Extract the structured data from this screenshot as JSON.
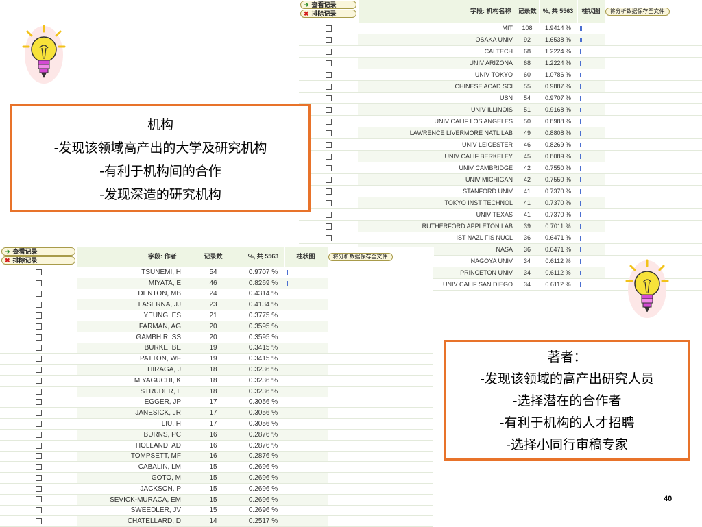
{
  "institution_table": {
    "buttons": {
      "view_records": "查看记录",
      "exclude_records": "排除记录"
    },
    "headers": {
      "field": "字段: 机构名称",
      "records": "记录数",
      "percent": "%, 共 5563",
      "bar": "柱状图",
      "save": "将分析数据保存至文件"
    },
    "rows": [
      {
        "name": "MIT",
        "count": "108",
        "pct": "1.9414 %",
        "share": 1.9414
      },
      {
        "name": "OSAKA UNIV",
        "count": "92",
        "pct": "1.6538 %",
        "share": 1.6538
      },
      {
        "name": "CALTECH",
        "count": "68",
        "pct": "1.2224 %",
        "share": 1.2224
      },
      {
        "name": "UNIV ARIZONA",
        "count": "68",
        "pct": "1.2224 %",
        "share": 1.2224
      },
      {
        "name": "UNIV TOKYO",
        "count": "60",
        "pct": "1.0786 %",
        "share": 1.0786
      },
      {
        "name": "CHINESE ACAD SCI",
        "count": "55",
        "pct": "0.9887 %",
        "share": 0.9887
      },
      {
        "name": "USN",
        "count": "54",
        "pct": "0.9707 %",
        "share": 0.9707
      },
      {
        "name": "UNIV ILLINOIS",
        "count": "51",
        "pct": "0.9168 %",
        "share": 0.9168
      },
      {
        "name": "UNIV CALIF LOS ANGELES",
        "count": "50",
        "pct": "0.8988 %",
        "share": 0.8988
      },
      {
        "name": "LAWRENCE LIVERMORE NATL LAB",
        "count": "49",
        "pct": "0.8808 %",
        "share": 0.8808
      },
      {
        "name": "UNIV LEICESTER",
        "count": "46",
        "pct": "0.8269 %",
        "share": 0.8269
      },
      {
        "name": "UNIV CALIF BERKELEY",
        "count": "45",
        "pct": "0.8089 %",
        "share": 0.8089
      },
      {
        "name": "UNIV CAMBRIDGE",
        "count": "42",
        "pct": "0.7550 %",
        "share": 0.755
      },
      {
        "name": "UNIV MICHIGAN",
        "count": "42",
        "pct": "0.7550 %",
        "share": 0.755
      },
      {
        "name": "STANFORD UNIV",
        "count": "41",
        "pct": "0.7370 %",
        "share": 0.737
      },
      {
        "name": "TOKYO INST TECHNOL",
        "count": "41",
        "pct": "0.7370 %",
        "share": 0.737
      },
      {
        "name": "UNIV TEXAS",
        "count": "41",
        "pct": "0.7370 %",
        "share": 0.737
      },
      {
        "name": "RUTHERFORD APPLETON LAB",
        "count": "39",
        "pct": "0.7011 %",
        "share": 0.7011
      },
      {
        "name": "IST NAZL FIS NUCL",
        "count": "36",
        "pct": "0.6471 %",
        "share": 0.6471
      },
      {
        "name": "NASA",
        "count": "36",
        "pct": "0.6471 %",
        "share": 0.6471
      },
      {
        "name": "NAGOYA UNIV",
        "count": "34",
        "pct": "0.6112 %",
        "share": 0.6112
      },
      {
        "name": "PRINCETON UNIV",
        "count": "34",
        "pct": "0.6112 %",
        "share": 0.6112
      },
      {
        "name": "UNIV CALIF SAN DIEGO",
        "count": "34",
        "pct": "0.6112 %",
        "share": 0.6112
      }
    ]
  },
  "author_table": {
    "buttons": {
      "view_records": "查看记录",
      "exclude_records": "排除记录"
    },
    "headers": {
      "field": "字段: 作者",
      "records": "记录数",
      "percent": "%, 共 5563",
      "bar": "柱状图",
      "save": "将分析数据保存至文件"
    },
    "rows": [
      {
        "name": "TSUNEMI, H",
        "count": "54",
        "pct": "0.9707 %",
        "share": 0.9707
      },
      {
        "name": "MIYATA, E",
        "count": "46",
        "pct": "0.8269 %",
        "share": 0.8269
      },
      {
        "name": "DENTON, MB",
        "count": "24",
        "pct": "0.4314 %",
        "share": 0.4314
      },
      {
        "name": "LASERNA, JJ",
        "count": "23",
        "pct": "0.4134 %",
        "share": 0.4134
      },
      {
        "name": "YEUNG, ES",
        "count": "21",
        "pct": "0.3775 %",
        "share": 0.3775
      },
      {
        "name": "FARMAN, AG",
        "count": "20",
        "pct": "0.3595 %",
        "share": 0.3595
      },
      {
        "name": "GAMBHIR, SS",
        "count": "20",
        "pct": "0.3595 %",
        "share": 0.3595
      },
      {
        "name": "BURKE, BE",
        "count": "19",
        "pct": "0.3415 %",
        "share": 0.3415
      },
      {
        "name": "PATTON, WF",
        "count": "19",
        "pct": "0.3415 %",
        "share": 0.3415
      },
      {
        "name": "HIRAGA, J",
        "count": "18",
        "pct": "0.3236 %",
        "share": 0.3236
      },
      {
        "name": "MIYAGUCHI, K",
        "count": "18",
        "pct": "0.3236 %",
        "share": 0.3236
      },
      {
        "name": "STRUDER, L",
        "count": "18",
        "pct": "0.3236 %",
        "share": 0.3236
      },
      {
        "name": "EGGER, JP",
        "count": "17",
        "pct": "0.3056 %",
        "share": 0.3056
      },
      {
        "name": "JANESICK, JR",
        "count": "17",
        "pct": "0.3056 %",
        "share": 0.3056
      },
      {
        "name": "LIU, H",
        "count": "17",
        "pct": "0.3056 %",
        "share": 0.3056
      },
      {
        "name": "BURNS, PC",
        "count": "16",
        "pct": "0.2876 %",
        "share": 0.2876
      },
      {
        "name": "HOLLAND, AD",
        "count": "16",
        "pct": "0.2876 %",
        "share": 0.2876
      },
      {
        "name": "TOMPSETT, MF",
        "count": "16",
        "pct": "0.2876 %",
        "share": 0.2876
      },
      {
        "name": "CABALIN, LM",
        "count": "15",
        "pct": "0.2696 %",
        "share": 0.2696
      },
      {
        "name": "GOTO, M",
        "count": "15",
        "pct": "0.2696 %",
        "share": 0.2696
      },
      {
        "name": "JACKSON, P",
        "count": "15",
        "pct": "0.2696 %",
        "share": 0.2696
      },
      {
        "name": "SEVICK-MURACA, EM",
        "count": "15",
        "pct": "0.2696 %",
        "share": 0.2696
      },
      {
        "name": "SWEEDLER, JV",
        "count": "15",
        "pct": "0.2696 %",
        "share": 0.2696
      },
      {
        "name": "CHATELLARD, D",
        "count": "14",
        "pct": "0.2517 %",
        "share": 0.2517
      }
    ]
  },
  "callout_institution": {
    "lines": [
      "机构",
      "-发现该领域高产出的大学及研究机构",
      "-有利于机构间的合作",
      "-发现深造的研究机构"
    ]
  },
  "callout_author": {
    "lines": [
      "著者：",
      "-发现该领域的高产出研究人员",
      "-选择潜在的合作者",
      "-有利于机构的人才招聘",
      "-选择小同行审稿专家"
    ]
  },
  "page_number": "40",
  "colors": {
    "callout_border": "#e8732a",
    "header_bg": "#eef5e4",
    "bar": "#4a6ed0",
    "bulb": "#f7e23a"
  },
  "icons": {
    "view": "arrow-right-icon",
    "exclude": "x-icon",
    "decor": "lightbulb-icon"
  }
}
